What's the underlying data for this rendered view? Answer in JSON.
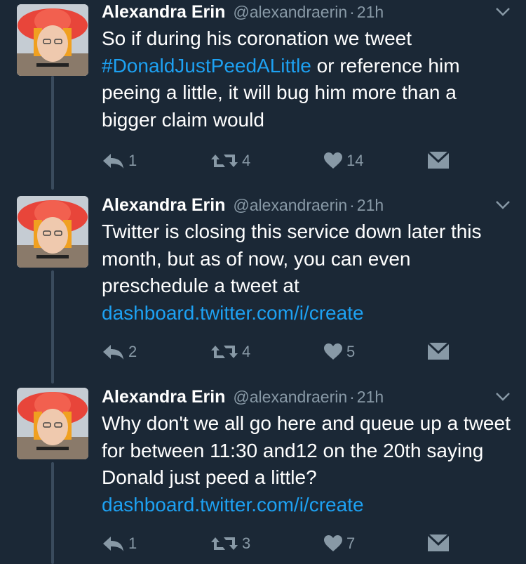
{
  "colors": {
    "background": "#1b2836",
    "text": "#ffffff",
    "muted": "#8899a6",
    "link": "#1da1f2"
  },
  "tweets": [
    {
      "name": "Alexandra Erin",
      "handle": "@alexandraerin",
      "sep": "·",
      "time": "21h",
      "text_before": "So if during his coronation we tweet ",
      "hashtag": "#DonaldJustPeedALittle",
      "text_after": " or reference him peeing a little, it will bug him more than a bigger claim would",
      "replies": "1",
      "retweets": "4",
      "likes": "14"
    },
    {
      "name": "Alexandra Erin",
      "handle": "@alexandraerin",
      "sep": "·",
      "time": "21h",
      "text_before": "Twitter is closing this service down later this month, but as of now, you can even preschedule a tweet at ",
      "link": "dashboard.twitter.com/i/create",
      "replies": "2",
      "retweets": "4",
      "likes": "5"
    },
    {
      "name": "Alexandra Erin",
      "handle": "@alexandraerin",
      "sep": "·",
      "time": "21h",
      "text_before": "Why don't we all go here and queue up a tweet for between 11:30 and12 on the 20th saying Donald just peed a little? ",
      "link": "dashboard.twitter.com/i/create",
      "replies": "1",
      "retweets": "3",
      "likes": "7"
    }
  ]
}
